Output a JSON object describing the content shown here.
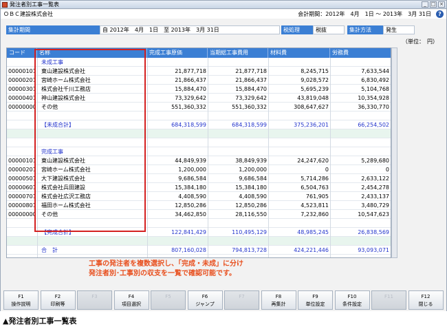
{
  "window": {
    "title": "発注者別工事一覧表",
    "minimize": "_",
    "maximize": "□",
    "close": "×"
  },
  "info": {
    "company": "ＯＢＣ建設株式会社",
    "period": "会計期間：2012年　4月　1日 ～ 2013年　3月 31日",
    "help_icon": "?"
  },
  "conditions": {
    "period_label": "集計期間",
    "period_value": "自 2012年　4月　1日　至 2013年　3月 31日",
    "tax_label": "税処理",
    "tax_value": "税抜",
    "method_label": "集計方法",
    "method_value": "発生"
  },
  "unit": "（単位：　円）",
  "grid": {
    "headers": [
      "コード",
      "名称",
      "完成工事原価",
      "当期総工事費用",
      "材料費",
      "労務費"
    ],
    "rows": [
      {
        "code": "",
        "name": "未成工事",
        "v1": "",
        "v2": "",
        "v3": "",
        "v4": "",
        "style": "section"
      },
      {
        "code": "00000101",
        "name": "東山建設株式会社",
        "v1": "21,877,718",
        "v2": "21,877,718",
        "v3": "8,245,715",
        "v4": "7,633,544"
      },
      {
        "code": "00000201",
        "name": "宮崎ホーム株式会社",
        "v1": "21,866,437",
        "v2": "21,866,437",
        "v3": "9,028,572",
        "v4": "6,830,492"
      },
      {
        "code": "00000301",
        "name": "株式会社千川工務店",
        "v1": "15,884,470",
        "v2": "15,884,470",
        "v3": "5,695,239",
        "v4": "5,104,768"
      },
      {
        "code": "00000401",
        "name": "神山建設株式会社",
        "v1": "73,329,642",
        "v2": "73,329,642",
        "v3": "43,819,048",
        "v4": "10,354,928"
      },
      {
        "code": "00000000",
        "name": "その他",
        "v1": "551,360,332",
        "v2": "551,360,332",
        "v3": "308,647,627",
        "v4": "36,330,770"
      },
      {
        "code": "",
        "name": "",
        "v1": "",
        "v2": "",
        "v3": "",
        "v4": ""
      },
      {
        "code": "",
        "name": "【未成合計】",
        "v1": "684,318,599",
        "v2": "684,318,599",
        "v3": "375,236,201",
        "v4": "66,254,502",
        "style": "total"
      },
      {
        "code": "",
        "name": "",
        "v1": "",
        "v2": "",
        "v3": "",
        "v4": "",
        "style": "shaded"
      },
      {
        "code": "",
        "name": "",
        "v1": "",
        "v2": "",
        "v3": "",
        "v4": ""
      },
      {
        "code": "",
        "name": "完成工事",
        "v1": "",
        "v2": "",
        "v3": "",
        "v4": "",
        "style": "section"
      },
      {
        "code": "00000101",
        "name": "東山建設株式会社",
        "v1": "44,849,939",
        "v2": "38,849,939",
        "v3": "24,247,620",
        "v4": "5,289,680"
      },
      {
        "code": "00000201",
        "name": "宮崎ホーム株式会社",
        "v1": "1,200,000",
        "v2": "1,200,000",
        "v3": "0",
        "v4": "0"
      },
      {
        "code": "00000501",
        "name": "大下建設株式会社",
        "v1": "9,686,584",
        "v2": "9,686,584",
        "v3": "5,714,286",
        "v4": "2,633,122"
      },
      {
        "code": "00000601",
        "name": "株式会社兵田建設",
        "v1": "15,384,180",
        "v2": "15,384,180",
        "v3": "6,504,763",
        "v4": "2,454,278"
      },
      {
        "code": "00000701",
        "name": "株式会社広沢工務店",
        "v1": "4,408,590",
        "v2": "4,408,590",
        "v3": "761,905",
        "v4": "2,433,137"
      },
      {
        "code": "00000801",
        "name": "福田ホーム株式会社",
        "v1": "12,850,286",
        "v2": "12,850,286",
        "v3": "4,523,811",
        "v4": "3,480,729"
      },
      {
        "code": "00000000",
        "name": "その他",
        "v1": "34,462,850",
        "v2": "28,116,550",
        "v3": "7,232,860",
        "v4": "10,547,623"
      },
      {
        "code": "",
        "name": "",
        "v1": "",
        "v2": "",
        "v3": "",
        "v4": ""
      },
      {
        "code": "",
        "name": "【完成合計】",
        "v1": "122,841,429",
        "v2": "110,495,129",
        "v3": "48,985,245",
        "v4": "26,838,569",
        "style": "total"
      },
      {
        "code": "",
        "name": "",
        "v1": "",
        "v2": "",
        "v3": "",
        "v4": "",
        "style": "shaded"
      },
      {
        "code": "",
        "name": "合　計",
        "v1": "807,160,028",
        "v2": "794,813,728",
        "v3": "424,221,446",
        "v4": "93,093,071",
        "style": "total"
      },
      {
        "code": "",
        "name": "",
        "v1": "",
        "v2": "",
        "v3": "",
        "v4": ""
      },
      {
        "code": "",
        "name": "",
        "v1": "",
        "v2": "",
        "v3": "",
        "v4": ""
      }
    ]
  },
  "annotation": {
    "line1": "工事の発注者を複数選択し、「完成・未成」に分け",
    "line2": "発注者別･工事別の収支を一覧で確認可能です。"
  },
  "fkeys": [
    {
      "key": "F1",
      "label": "操作説明",
      "enabled": true
    },
    {
      "key": "F2",
      "label": "印刷等",
      "enabled": true
    },
    {
      "key": "F3",
      "label": "",
      "enabled": false
    },
    {
      "key": "F4",
      "label": "項目選択",
      "enabled": true
    },
    {
      "key": "F5",
      "label": "",
      "enabled": false
    },
    {
      "key": "F6",
      "label": "ジャンプ",
      "enabled": true
    },
    {
      "key": "F7",
      "label": "",
      "enabled": false
    },
    {
      "key": "F8",
      "label": "再集計",
      "enabled": true
    },
    {
      "key": "F9",
      "label": "単位設定",
      "enabled": true
    },
    {
      "key": "F10",
      "label": "条件設定",
      "enabled": true
    },
    {
      "key": "F11",
      "label": "",
      "enabled": false
    },
    {
      "key": "F12",
      "label": "閉じる",
      "enabled": true
    }
  ],
  "caption": "▲発注者別工事一覧表",
  "colors": {
    "header_blue": "#3b7fd4",
    "total_blue": "#2233cc",
    "highlight_red": "#d42020",
    "annotation_orange": "#e8501f"
  }
}
